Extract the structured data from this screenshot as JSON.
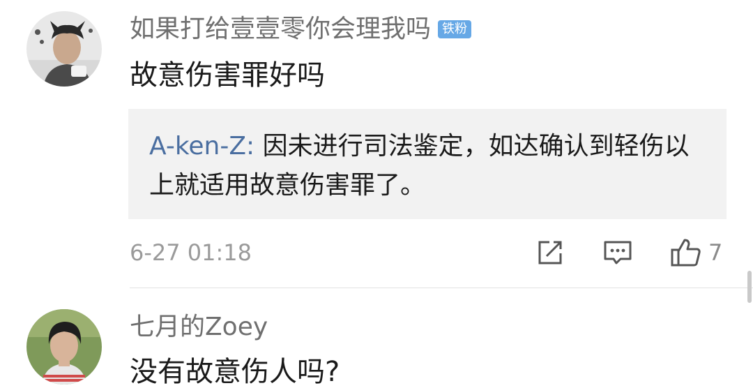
{
  "comments": [
    {
      "username": "如果打给壹壹零你会理我吗",
      "badge": "铁粉",
      "text": "故意伤害罪好吗",
      "reply": {
        "author": "A-ken-Z",
        "separator": ": ",
        "text": "因未进行司法鉴定，如达确认到轻伤以上就适用故意伤害罪了。"
      },
      "timestamp": "6-27 01:18",
      "like_count": "7",
      "icons": [
        "share-icon",
        "comment-icon",
        "like-icon"
      ]
    },
    {
      "username": "七月的Zoey",
      "text": "没有故意伤人吗?"
    }
  ],
  "colors": {
    "username": "#6f6f6f",
    "reply_author": "#4a6ea0",
    "badge": "#66a8e6",
    "reply_background": "#f2f2f2",
    "meta": "#9a9a9a"
  }
}
